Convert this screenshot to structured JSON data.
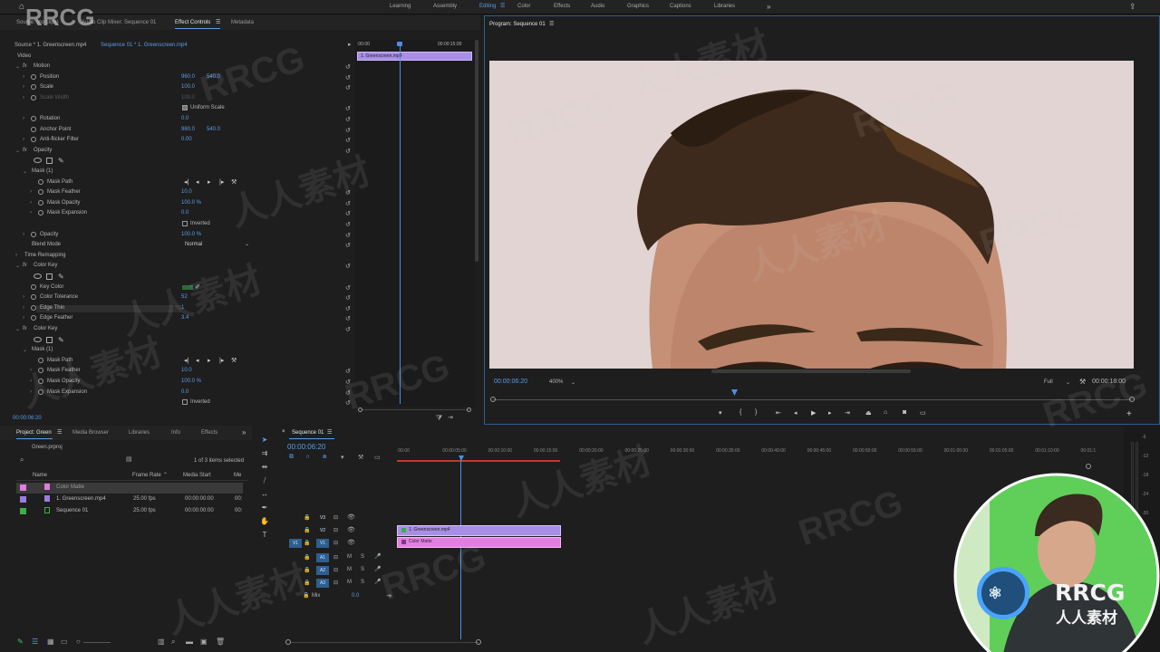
{
  "topbar": {
    "workspaces": [
      "Learning",
      "Assembly",
      "Editing",
      "Color",
      "Effects",
      "Audio",
      "Graphics",
      "Captions",
      "Libraries"
    ],
    "active": "Editing",
    "more": "»"
  },
  "source_panel": {
    "tabs": [
      "Source: (no clips)",
      "Audio Clip Mixer: Sequence 01",
      "Effect Controls",
      "Metadata"
    ],
    "active_tab": "Effect Controls",
    "clip_path": "Source * 1. Greenscreen.mp4",
    "seq_path": "Sequence 01 * 1. Greenscreen.mp4",
    "mini_time_start": ":00:00",
    "mini_time_end": "00:00:15:00",
    "mini_clip_label": "1. Greenscreen.mp4",
    "section": "Video",
    "timecode": "00:00:06:20"
  },
  "effects": [
    {
      "indent": 0,
      "twirl": "v",
      "fx": true,
      "label": "Motion",
      "value": "",
      "value2": "",
      "reset": true
    },
    {
      "indent": 1,
      "twirl": ">",
      "sw": true,
      "label": "Position",
      "value": "960.0",
      "value2": "540.0",
      "reset": true
    },
    {
      "indent": 1,
      "twirl": ">",
      "sw": true,
      "label": "Scale",
      "value": "100.0",
      "value2": "",
      "reset": true
    },
    {
      "indent": 1,
      "twirl": ">",
      "sw": true,
      "label": "Scale Width",
      "value": "100.0",
      "value2": "",
      "reset": false,
      "disabled": true
    },
    {
      "indent": 1,
      "twirl": "",
      "sw": false,
      "label": "",
      "checkbox": "Uniform Scale",
      "checked": true,
      "reset": true
    },
    {
      "indent": 1,
      "twirl": ">",
      "sw": true,
      "label": "Rotation",
      "value": "0.0",
      "value2": "",
      "reset": true
    },
    {
      "indent": 1,
      "twirl": "",
      "sw": true,
      "label": "Anchor Point",
      "value": "960.0",
      "value2": "540.0",
      "reset": true
    },
    {
      "indent": 1,
      "twirl": ">",
      "sw": true,
      "label": "Anti-flicker Filter",
      "value": "0.00",
      "value2": "",
      "reset": true
    },
    {
      "indent": 0,
      "twirl": "v",
      "fx": true,
      "label": "Opacity",
      "value": "",
      "value2": "",
      "reset": true
    },
    {
      "indent": 1,
      "shapes": true,
      "reset": false
    },
    {
      "indent": 1,
      "twirl": "v",
      "label": "Mask (1)",
      "value": "",
      "value2": "",
      "reset": false
    },
    {
      "indent": 2,
      "twirl": "",
      "sw": true,
      "label": "Mask Path",
      "maskctrl": true,
      "reset": false
    },
    {
      "indent": 2,
      "twirl": ">",
      "sw": true,
      "label": "Mask Feather",
      "value": "10.0",
      "value2": "",
      "reset": true
    },
    {
      "indent": 2,
      "twirl": ">",
      "sw": true,
      "label": "Mask Opacity",
      "value": "100.0 %",
      "value2": "",
      "reset": true
    },
    {
      "indent": 2,
      "twirl": ">",
      "sw": true,
      "label": "Mask Expansion",
      "value": "0.0",
      "value2": "",
      "reset": true
    },
    {
      "indent": 2,
      "twirl": "",
      "sw": false,
      "label": "",
      "checkbox": "Inverted",
      "checked": false,
      "reset": true
    },
    {
      "indent": 1,
      "twirl": ">",
      "sw": true,
      "label": "Opacity",
      "value": "100.0 %",
      "value2": "",
      "reset": true
    },
    {
      "indent": 1,
      "twirl": "",
      "sw": false,
      "label": "Blend Mode",
      "dropdown": "Normal",
      "reset": true
    },
    {
      "indent": 0,
      "twirl": ">",
      "fx": false,
      "label": "Time Remapping",
      "value": "",
      "value2": "",
      "reset": false
    },
    {
      "indent": 0,
      "twirl": "v",
      "fx": true,
      "label": "Color Key",
      "value": "",
      "value2": "",
      "reset": true
    },
    {
      "indent": 1,
      "shapes": true,
      "reset": false
    },
    {
      "indent": 1,
      "twirl": "",
      "sw": true,
      "label": "Key Color",
      "swatch": "#2e6b3a",
      "reset": true
    },
    {
      "indent": 1,
      "twirl": ">",
      "sw": true,
      "label": "Color Tolerance",
      "value": "52",
      "value2": "",
      "reset": true
    },
    {
      "indent": 1,
      "twirl": ">",
      "sw": true,
      "label": "Edge Thin",
      "value": "1",
      "value2": "",
      "reset": true,
      "highlight": true
    },
    {
      "indent": 1,
      "twirl": ">",
      "sw": true,
      "label": "Edge Feather",
      "value": "3.4",
      "value2": "",
      "reset": true
    },
    {
      "indent": 0,
      "twirl": "v",
      "fx": true,
      "label": "Color Key",
      "value": "",
      "value2": "",
      "reset": true
    },
    {
      "indent": 1,
      "shapes": true,
      "reset": false
    },
    {
      "indent": 1,
      "twirl": "v",
      "label": "Mask (1)",
      "value": "",
      "value2": "",
      "reset": false
    },
    {
      "indent": 2,
      "twirl": "",
      "sw": true,
      "label": "Mask Path",
      "maskctrl": true,
      "reset": false
    },
    {
      "indent": 2,
      "twirl": ">",
      "sw": true,
      "label": "Mask Feather",
      "value": "10.0",
      "value2": "",
      "reset": true
    },
    {
      "indent": 2,
      "twirl": ">",
      "sw": true,
      "label": "Mask Opacity",
      "value": "100.0 %",
      "value2": "",
      "reset": true
    },
    {
      "indent": 2,
      "twirl": ">",
      "sw": true,
      "label": "Mask Expansion",
      "value": "0.0",
      "value2": "",
      "reset": true
    },
    {
      "indent": 2,
      "twirl": "",
      "sw": false,
      "label": "",
      "checkbox": "Inverted",
      "checked": false,
      "reset": true
    }
  ],
  "program": {
    "title": "Program: Sequence 01",
    "timecode": "00:00:06:20",
    "zoom": "400%",
    "quality": "Full",
    "duration": "00:00:18:00",
    "video_bg": "#e1d4d2"
  },
  "project": {
    "tabs": [
      "Project: Green",
      "Media Browser",
      "Libraries",
      "Info",
      "Effects"
    ],
    "active_tab": "Project: Green",
    "file": "Green.prproj",
    "selected": "1 of 3 items selected",
    "cols": [
      "Name",
      "Frame Rate",
      "Media Start",
      "Me"
    ],
    "items": [
      {
        "color": "#e07be0",
        "name": "Color Matte",
        "rate": "",
        "start": "",
        "selected": true
      },
      {
        "color": "#9b7be0",
        "name": "1. Greenscreen.mp4",
        "rate": "25.00 fps",
        "start": "00:00:00:00",
        "selected": false
      },
      {
        "color": "#3fae4a",
        "name": "Sequence 01",
        "rate": "25.00 fps",
        "start": "00:00:00:00",
        "selected": false
      }
    ]
  },
  "timeline": {
    "tab": "Sequence 01",
    "timecode": "00:00:06:20",
    "ruler": [
      ":00:00",
      "00:00:05:00",
      "00:00:10:00",
      "00:00:15:00",
      "00:00:20:00",
      "00:00:25:00",
      "00:00:30:00",
      "00:00:35:00",
      "00:00:40:00",
      "00:00:45:00",
      "00:00:50:00",
      "00:00:55:00",
      "00:01:00:00",
      "00:01:05:00",
      "00:01:10:00",
      "00:01:1"
    ],
    "video_tracks": [
      "V3",
      "V2",
      "V1"
    ],
    "audio_tracks": [
      "A1",
      "A2",
      "A3"
    ],
    "mix_label": "Mix",
    "mix_value": "0.0",
    "clip_v2": "1. Greenscreen.mp4",
    "clip_v1": "Color Matte",
    "src_patch": "V1"
  },
  "meter_labels": [
    "-6",
    "-12",
    "-18",
    "-24",
    "-30",
    "-36"
  ],
  "watermarks": {
    "rrcg": "RRCG",
    "cn": "人人素材",
    "logo_big": "RRCG",
    "logo_small": "人人素材"
  },
  "colors": {
    "accent": "#5c9ce6",
    "clip_purple": "#a98ee6",
    "clip_pink": "#e27fe2",
    "playhead": "#4a90e2"
  }
}
